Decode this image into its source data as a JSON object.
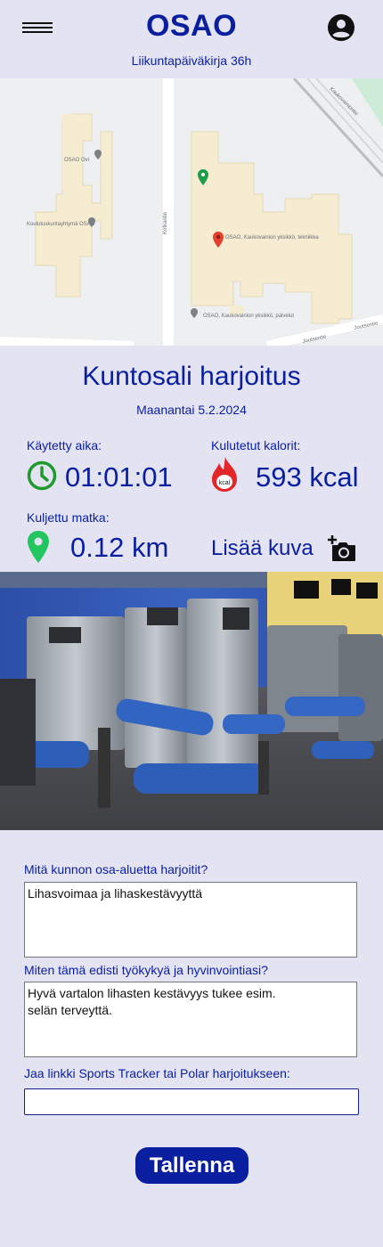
{
  "header": {
    "brand": "OSAO",
    "subtitle": "Liikuntapäiväkirja 36h",
    "menu_icon": "hamburger-menu-icon",
    "account_icon": "account-circle-icon"
  },
  "map": {
    "labels": [
      "OSAO Ovi",
      "Koulutuskuntayhtymä OSAO",
      "Kotkantie",
      "OSAO, Kaukovainion yksikkö, tekniikka",
      "OSAO, Kaukovainion yksikkö, palvelut",
      "Joutsentie",
      "Joutsentie",
      "Kaukovainiontie"
    ]
  },
  "workout": {
    "title": "Kuntosali harjoitus",
    "date": "Maanantai 5.2.2024"
  },
  "stats": {
    "time_label": "Käytetty aika:",
    "time_value": "01:01:01",
    "time_icon": "clock-icon",
    "calories_label": "Kulutetut kalorit:",
    "calories_value": "593 kcal",
    "calories_icon": "kcal-flame-icon",
    "calories_icon_text": "kcal",
    "distance_label": "Kuljettu matka:",
    "distance_value": "0.12 km",
    "distance_icon": "location-pin-icon",
    "add_photo_label": "Lisää kuva",
    "add_photo_icon": "add-photo-camera-icon"
  },
  "form": {
    "q1_label": "Mitä kunnon osa-aluetta harjoitit?",
    "q1_value": "Lihasvoimaa ja lihaskestävyyttä",
    "q2_label": "Miten tämä edisti työkykyä ja hyvinvointiasi?",
    "q2_value": "Hyvä vartalon lihasten kestävyys tukee esim.\nselän terveyttä.",
    "q3_label": "Jaa linkki Sports Tracker tai Polar harjoitukseen:",
    "q3_value": "",
    "save_label": "Tallenna"
  },
  "colors": {
    "background": "#e3e3f1",
    "primary": "#0a1ea0",
    "clock_green": "#1f9a2e",
    "pin_green": "#22c55e",
    "flame_red": "#e3262a"
  }
}
